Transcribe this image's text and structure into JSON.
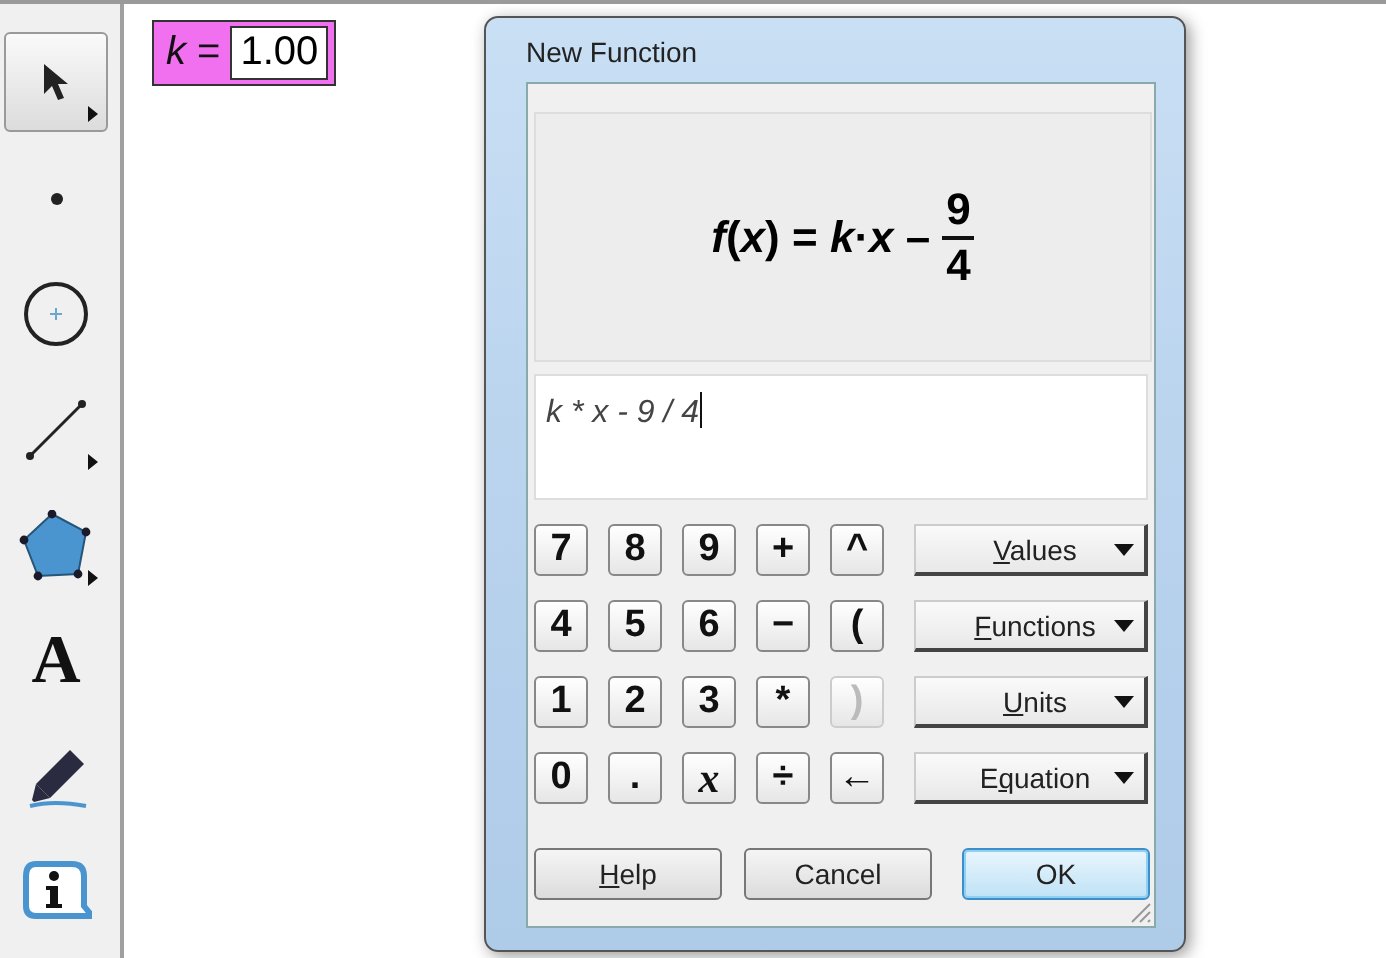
{
  "toolbox": {
    "tools": [
      {
        "kind": "arrow",
        "selected": true,
        "submenu": true
      },
      {
        "kind": "point",
        "selected": false,
        "submenu": false
      },
      {
        "kind": "compass",
        "selected": false,
        "submenu": false
      },
      {
        "kind": "line",
        "selected": false,
        "submenu": true
      },
      {
        "kind": "polygon",
        "selected": false,
        "submenu": true
      },
      {
        "kind": "text",
        "label": "A",
        "selected": false,
        "submenu": false
      },
      {
        "kind": "marker",
        "selected": false,
        "submenu": false
      },
      {
        "kind": "info",
        "selected": false,
        "submenu": false
      }
    ]
  },
  "parameter": {
    "label": "*k* =",
    "value": "1.00"
  },
  "dialog": {
    "title": "New Function",
    "preview": {
      "expression": "*f*(*x*) = *k*·*x* –",
      "numerator": "9",
      "denominator": "4"
    },
    "input": {
      "value": "k * x - 9 / 4"
    },
    "keypad": [
      [
        {
          "label": "7",
          "kind": "digit",
          "disabled": false
        },
        {
          "label": "8",
          "kind": "digit",
          "disabled": false
        },
        {
          "label": "9",
          "kind": "digit",
          "disabled": false
        },
        {
          "label": "+",
          "kind": "operator",
          "disabled": false
        },
        {
          "label": "^",
          "kind": "operator",
          "disabled": false
        }
      ],
      [
        {
          "label": "4",
          "kind": "digit",
          "disabled": false
        },
        {
          "label": "5",
          "kind": "digit",
          "disabled": false
        },
        {
          "label": "6",
          "kind": "digit",
          "disabled": false
        },
        {
          "label": "−",
          "kind": "operator",
          "disabled": false
        },
        {
          "label": "(",
          "kind": "operator",
          "disabled": false
        }
      ],
      [
        {
          "label": "1",
          "kind": "digit",
          "disabled": false
        },
        {
          "label": "2",
          "kind": "digit",
          "disabled": false
        },
        {
          "label": "3",
          "kind": "digit",
          "disabled": false
        },
        {
          "label": "*",
          "kind": "operator",
          "disabled": false
        },
        {
          "label": ")",
          "kind": "operator",
          "disabled": true
        }
      ],
      [
        {
          "label": "0",
          "kind": "digit",
          "disabled": false
        },
        {
          "label": ".",
          "kind": "digit",
          "disabled": false
        },
        {
          "label": "x",
          "kind": "variable",
          "disabled": false
        },
        {
          "label": "÷",
          "kind": "operator",
          "disabled": false
        },
        {
          "label": "←",
          "kind": "operator",
          "disabled": false
        }
      ]
    ],
    "menus": [
      {
        "key": "V",
        "after": "alues"
      },
      {
        "key": "F",
        "after": "unctions"
      },
      {
        "key": "U",
        "after": "nits"
      },
      {
        "before": "E",
        "key": "q",
        "after": "uation"
      }
    ],
    "buttons": [
      {
        "key": "H",
        "after": "elp",
        "default": false
      },
      {
        "before": "Cancel",
        "default": false
      },
      {
        "before": "OK",
        "default": true
      }
    ]
  }
}
